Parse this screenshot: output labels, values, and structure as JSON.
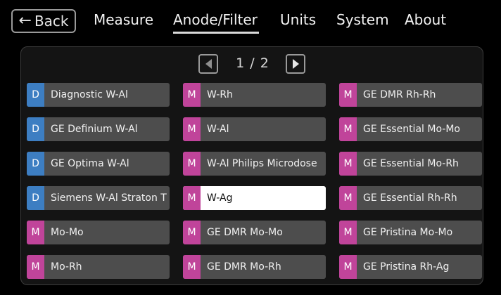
{
  "nav": {
    "back_label": "Back",
    "tabs": [
      {
        "label": "Measure",
        "active": false
      },
      {
        "label": "Anode/Filter",
        "active": true
      },
      {
        "label": "Units",
        "active": false
      },
      {
        "label": "System",
        "active": false
      },
      {
        "label": "About",
        "active": false
      }
    ]
  },
  "pager": {
    "text": "1 / 2",
    "current_page": 1,
    "total_pages": 2
  },
  "colors": {
    "D": "#3d7ec2",
    "M": "#c0449a",
    "item_bg": "#4d4d4d",
    "selected_bg": "#ffffff"
  },
  "columns": [
    [
      {
        "type": "D",
        "label": "Diagnostic W-Al"
      },
      {
        "type": "D",
        "label": "GE Definium W-Al"
      },
      {
        "type": "D",
        "label": "GE Optima W-Al"
      },
      {
        "type": "D",
        "label": "Siemens W-Al Straton T"
      },
      {
        "type": "M",
        "label": "Mo-Mo"
      },
      {
        "type": "M",
        "label": "Mo-Rh"
      }
    ],
    [
      {
        "type": "M",
        "label": "W-Rh"
      },
      {
        "type": "M",
        "label": "W-Al"
      },
      {
        "type": "M",
        "label": "W-Al Philips Microdose"
      },
      {
        "type": "M",
        "label": "W-Ag",
        "selected": true
      },
      {
        "type": "M",
        "label": "GE DMR Mo-Mo"
      },
      {
        "type": "M",
        "label": "GE DMR Mo-Rh"
      }
    ],
    [
      {
        "type": "M",
        "label": "GE DMR Rh-Rh"
      },
      {
        "type": "M",
        "label": "GE Essential Mo-Mo"
      },
      {
        "type": "M",
        "label": "GE Essential Mo-Rh"
      },
      {
        "type": "M",
        "label": "GE Essential Rh-Rh"
      },
      {
        "type": "M",
        "label": "GE Pristina Mo-Mo"
      },
      {
        "type": "M",
        "label": "GE Pristina Rh-Ag"
      }
    ]
  ]
}
